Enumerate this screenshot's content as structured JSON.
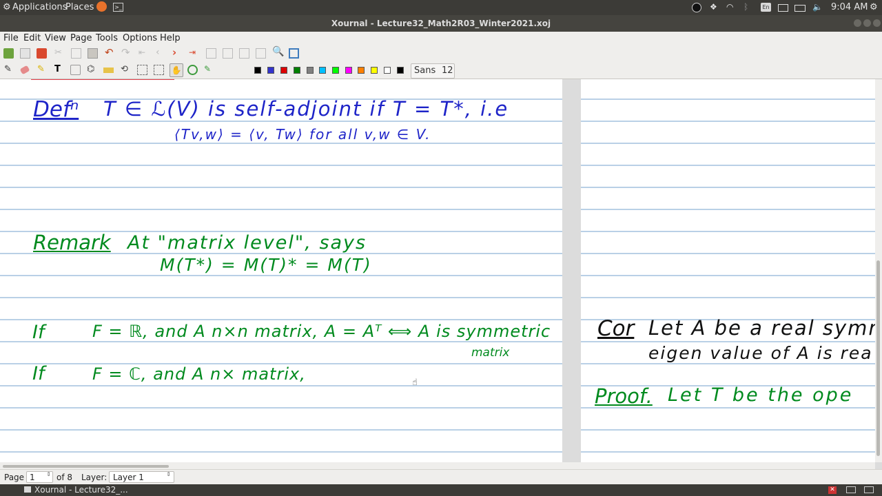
{
  "top_panel": {
    "applications": "Applications",
    "places": "Places",
    "clock": "9:04 AM",
    "keyboard_layout": "En"
  },
  "window": {
    "title": "Xournal - Lecture32_Math2R03_Winter2021.xoj"
  },
  "menu": [
    "File",
    "Edit",
    "View",
    "Page",
    "Tools",
    "Options",
    "Help"
  ],
  "toolbar": {
    "font_name": "Sans",
    "font_size": "12"
  },
  "colors": {
    "palette": [
      "#000000",
      "#3333cc",
      "#dd0000",
      "#008000",
      "#808080",
      "#00c0ff",
      "#00ff00",
      "#ff00ff",
      "#ff8000",
      "#ffff00",
      "#ffffff",
      "#000000"
    ],
    "ink_blue": "#1e24c8",
    "ink_green": "#008a1e"
  },
  "page1": {
    "defn_label": "Defⁿ",
    "defn_line1": "T ∈ ℒ(V) is self-adjoint if T = T*, i.e",
    "defn_line2": "⟨Tv,w⟩ = ⟨v, Tw⟩ for all v,w ∈ V.",
    "remark_label": "Remark",
    "remark_line1": "At \"matrix level\", says",
    "remark_line2": "M(T*) = M(T)* = M(T)",
    "line_r_if": "If",
    "line_r_text": "F = ℝ, and A n×n matrix, A = Aᵀ ⟺ A is symmetric",
    "line_r_cont": "matrix",
    "line_c_if": "If",
    "line_c_text": "F = ℂ, and A n× matrix,"
  },
  "page2": {
    "cor_label": "Cor",
    "cor_line1": "Let A be a real symmet",
    "cor_line2": "eigen value of A is rea",
    "proof_label": "Proof.",
    "proof_line": "Let T be the ope"
  },
  "status": {
    "page_label": "Page",
    "page_current": "1",
    "page_of": "of 8",
    "layer_label": "Layer:",
    "layer_value": "Layer 1"
  },
  "taskbar": {
    "window_button": "Xournal - Lecture32_..."
  }
}
